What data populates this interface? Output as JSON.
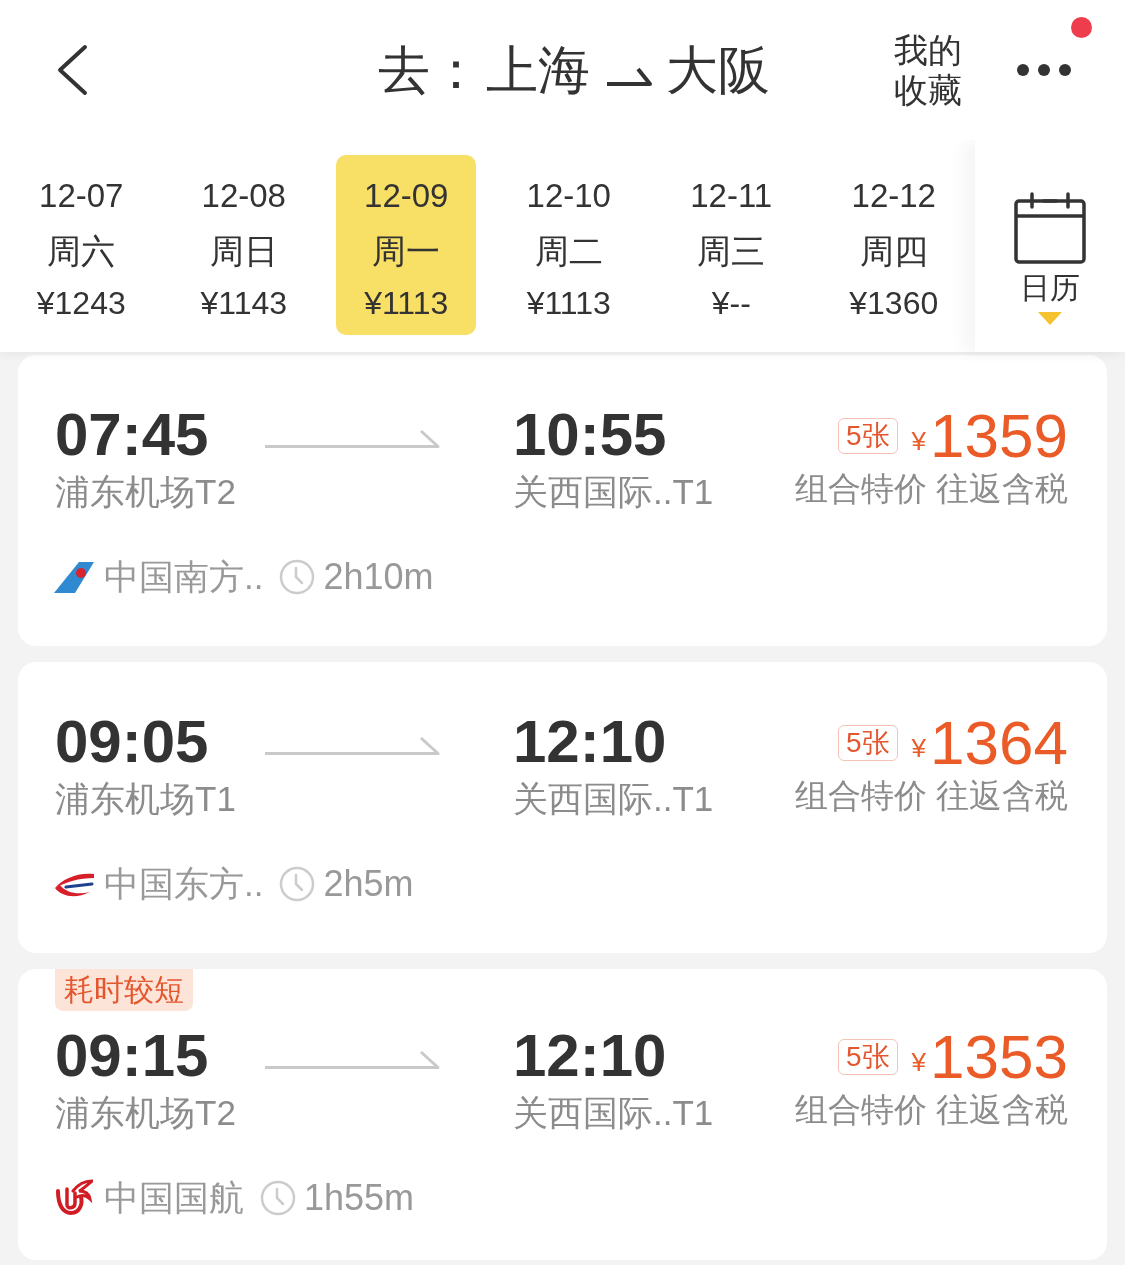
{
  "header": {
    "title": {
      "prefix": "去：",
      "origin": "上海",
      "destination": "大阪"
    },
    "favorites": [
      "我的",
      "收藏"
    ],
    "more": {
      "badge": true
    }
  },
  "dates": [
    {
      "date": "12-07",
      "weekday": "周六",
      "price": "¥1243",
      "selected": false
    },
    {
      "date": "12-08",
      "weekday": "周日",
      "price": "¥1143",
      "selected": false
    },
    {
      "date": "12-09",
      "weekday": "周一",
      "price": "¥1113",
      "selected": true
    },
    {
      "date": "12-10",
      "weekday": "周二",
      "price": "¥1113",
      "selected": false
    },
    {
      "date": "12-11",
      "weekday": "周三",
      "price": "¥--",
      "selected": false
    },
    {
      "date": "12-12",
      "weekday": "周四",
      "price": "¥1360",
      "selected": false
    }
  ],
  "calendar": {
    "label": "日历"
  },
  "flights": [
    {
      "depart_time": "07:45",
      "depart_airport": "浦东机场T2",
      "arrive_time": "10:55",
      "arrive_airport": "关西国际..T1",
      "tickets": "5张",
      "currency": "¥",
      "price": "1359",
      "price_note": "组合特价 往返含税",
      "airline": {
        "kind": "tail",
        "name": "中国南方.."
      },
      "duration": "2h10m"
    },
    {
      "depart_time": "09:05",
      "depart_airport": "浦东机场T1",
      "arrive_time": "12:10",
      "arrive_airport": "关西国际..T1",
      "tickets": "5张",
      "currency": "¥",
      "price": "1364",
      "price_note": "组合特价 往返含税",
      "airline": {
        "kind": "swallow",
        "name": "中国东方.."
      },
      "duration": "2h5m"
    },
    {
      "tag": "耗时较短",
      "depart_time": "09:15",
      "depart_airport": "浦东机场T2",
      "arrive_time": "12:10",
      "arrive_airport": "关西国际..T1",
      "tickets": "5张",
      "currency": "¥",
      "price": "1353",
      "price_note": "组合特价 往返含税",
      "airline": {
        "kind": "swirl",
        "name": "中国国航"
      },
      "duration": "1h55m"
    }
  ]
}
